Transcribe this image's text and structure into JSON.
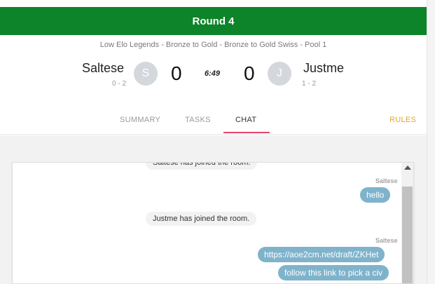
{
  "header": {
    "round_title": "Round 4"
  },
  "match": {
    "subtitle": "Low Elo Legends - Bronze to Gold - Bronze to Gold Swiss - Pool 1",
    "timer": "6:49",
    "player1": {
      "name": "Saltese",
      "record": "0 - 2",
      "avatar_letter": "S",
      "score": "0"
    },
    "player2": {
      "name": "Justme",
      "record": "1 - 2",
      "avatar_letter": "J",
      "score": "0"
    }
  },
  "tabs": [
    {
      "label": "SUMMARY"
    },
    {
      "label": "TASKS"
    },
    {
      "label": "CHAT",
      "active": true
    }
  ],
  "rules_label": "RULES",
  "chat": {
    "messages": [
      {
        "type": "system",
        "text": "Saltese has joined the room."
      },
      {
        "type": "sender",
        "text": "Saltese"
      },
      {
        "type": "user",
        "text": "hello"
      },
      {
        "type": "system",
        "text": "Justme has joined the room."
      },
      {
        "type": "sender",
        "text": "Saltese"
      },
      {
        "type": "user",
        "text": "https://aoe2cm.net/draft/ZKHet"
      },
      {
        "type": "user",
        "text": "follow this link to pick a civ"
      }
    ]
  },
  "colors": {
    "header_bg": "#0d8429",
    "active_tab_underline": "#e9456a",
    "rules": "#e5a722",
    "bubble": "#7fb3cc"
  }
}
